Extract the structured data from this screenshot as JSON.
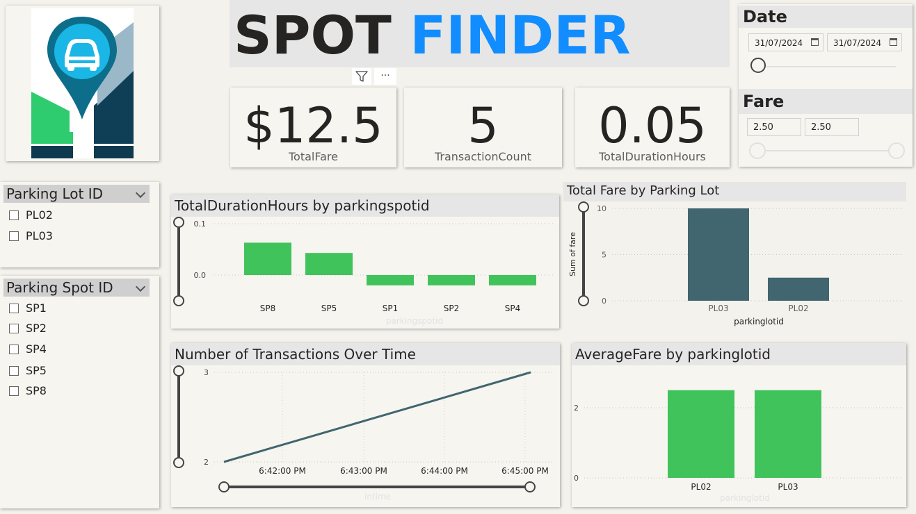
{
  "title": {
    "part1": "SPOT",
    "part2": "FINDER"
  },
  "colors": {
    "accent": "#118dff",
    "green": "#41c35b",
    "teal": "#41666f",
    "dark": "#252423"
  },
  "logo": {
    "icon": "car-location-pin-icon"
  },
  "visual_header": {
    "filter_icon": "filter-icon",
    "more_icon": "more-options-icon",
    "more_label": "···"
  },
  "kpis": [
    {
      "value": "$12.5",
      "label": "TotalFare"
    },
    {
      "value": "5",
      "label": "TransactionCount"
    },
    {
      "value": "0.05",
      "label": "TotalDurationHours"
    }
  ],
  "date_slicer": {
    "title": "Date",
    "start": "31/07/2024",
    "end": "31/07/2024"
  },
  "fare_slicer": {
    "title": "Fare",
    "min": "2.50",
    "max": "2.50"
  },
  "lot_slicer": {
    "title": "Parking Lot ID",
    "items": [
      "PL02",
      "PL03"
    ]
  },
  "spot_slicer": {
    "title": "Parking Spot ID",
    "items": [
      "SP1",
      "SP2",
      "SP4",
      "SP5",
      "SP8"
    ]
  },
  "chart_data": [
    {
      "id": "duration",
      "type": "bar",
      "title": "TotalDurationHours by parkingspotid",
      "xlabel": "parkingspotid",
      "ylabel": "",
      "categories": [
        "SP8",
        "SP5",
        "SP1",
        "SP2",
        "SP4"
      ],
      "values": [
        0.063,
        0.043,
        -0.02,
        -0.02,
        -0.02
      ],
      "ylim": [
        -0.02,
        0.1
      ],
      "yticks": [
        "0.1",
        "0.0"
      ],
      "grid": true
    },
    {
      "id": "fare_by_lot",
      "type": "bar",
      "title": "Total Fare by Parking Lot",
      "xlabel": "parkinglotid",
      "ylabel": "Sum of fare",
      "categories": [
        "PL03",
        "PL02"
      ],
      "values": [
        10,
        2.5
      ],
      "ylim": [
        0,
        10
      ],
      "yticks": [
        "10",
        "5",
        "0"
      ],
      "grid": true
    },
    {
      "id": "transactions",
      "type": "line",
      "title": "Number of Transactions Over Time",
      "xlabel": "intime",
      "ylabel": "",
      "x": [
        "6:41:30 PM",
        "6:45:00 PM"
      ],
      "xticks": [
        "6:42:00 PM",
        "6:43:00 PM",
        "6:44:00 PM",
        "6:45:00 PM"
      ],
      "values": [
        2,
        3
      ],
      "ylim": [
        2,
        3
      ],
      "yticks": [
        "3",
        "2"
      ],
      "grid": true
    },
    {
      "id": "avg_fare",
      "type": "bar",
      "title": "AverageFare by parkinglotid",
      "xlabel": "parkinglotid",
      "ylabel": "",
      "categories": [
        "PL02",
        "PL03"
      ],
      "values": [
        2.5,
        2.5
      ],
      "ylim": [
        0,
        3
      ],
      "yticks": [
        "2",
        "0"
      ],
      "grid": true
    }
  ]
}
